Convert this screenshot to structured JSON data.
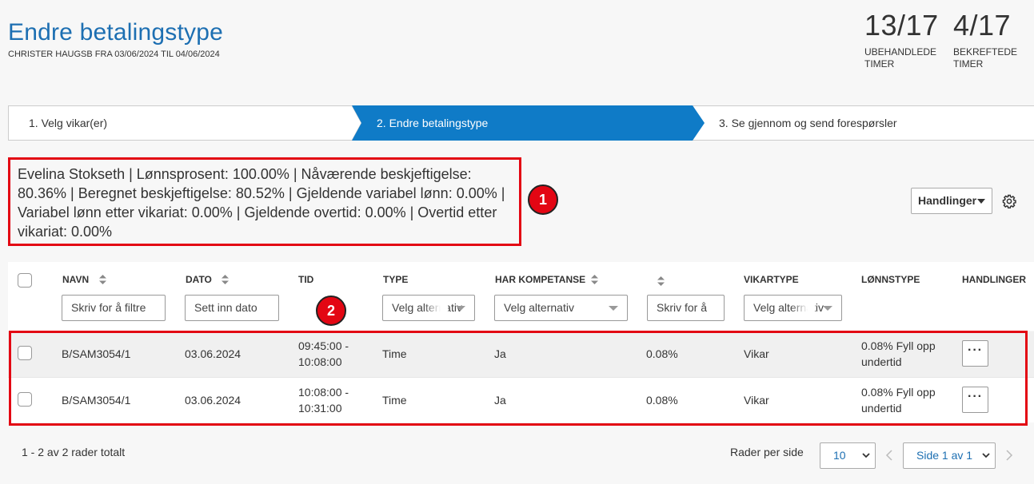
{
  "header": {
    "title": "Endre betalingstype",
    "subtitle": "CHRISTER HAUGSB FRA 03/06/2024 TIL 04/06/2024"
  },
  "stats": [
    {
      "value": "13/17",
      "label": "UBEHANDLEDE TIMER"
    },
    {
      "value": "4/17",
      "label": "BEKREFTEDE TIMER"
    }
  ],
  "steps": [
    {
      "label": "1. Velg vikar(er)"
    },
    {
      "label": "2. Endre betalingstype"
    },
    {
      "label": "3. Se gjennom og send forespørsler"
    }
  ],
  "info_text": "Evelina Stokseth | Lønnsprosent: 100.00% | Nåværende beskjeftigelse: 80.36% | Beregnet beskjeftigelse: 80.52% | Gjeldende variabel lønn: 0.00% | Variabel lønn etter vikariat: 0.00% | Gjeldende overtid: 0.00% | Overtid etter vikariat: 0.00%",
  "annotations": [
    "1",
    "2"
  ],
  "toolbar": {
    "actions_label": "Handlinger"
  },
  "table": {
    "columns": {
      "navn": "NAVN",
      "dato": "DATO",
      "tid": "TID",
      "type": "TYPE",
      "har_kompetanse": "HAR KOMPETANSE",
      "vikartype": "VIKARTYPE",
      "lonnstype": "LØNNSTYPE",
      "handlinger": "HANDLINGER"
    },
    "filters": {
      "navn": "Skriv for å filtre",
      "dato": "Sett inn dato",
      "type": "Velg alternativ",
      "har_kompetanse": "Velg alternativ",
      "pct": "Skriv for å",
      "vikartype": "Velg alternativ"
    },
    "rows": [
      {
        "navn": "B/SAM3054/1",
        "dato": "03.06.2024",
        "tid": [
          "09:45:00 -",
          "10:08:00"
        ],
        "type": "Time",
        "har_kompetanse": "Ja",
        "pct": "0.08%",
        "vikartype": "Vikar",
        "lonnstype": [
          "0.08% Fyll opp",
          "undertid"
        ],
        "action": "···"
      },
      {
        "navn": "B/SAM3054/1",
        "dato": "03.06.2024",
        "tid": [
          "10:08:00 -",
          "10:31:00"
        ],
        "type": "Time",
        "har_kompetanse": "Ja",
        "pct": "0.08%",
        "vikartype": "Vikar",
        "lonnstype": [
          "0.08% Fyll opp",
          "undertid"
        ],
        "action": "···"
      }
    ]
  },
  "footer": {
    "total": "1 - 2 av 2 rader totalt",
    "rows_per_page_label": "Rader per side",
    "rows_per_page": "10",
    "page": "Side 1 av 1"
  },
  "colors": {
    "accent": "#0f7bc7",
    "title": "#1d6fb2",
    "highlight": "#e30613"
  }
}
